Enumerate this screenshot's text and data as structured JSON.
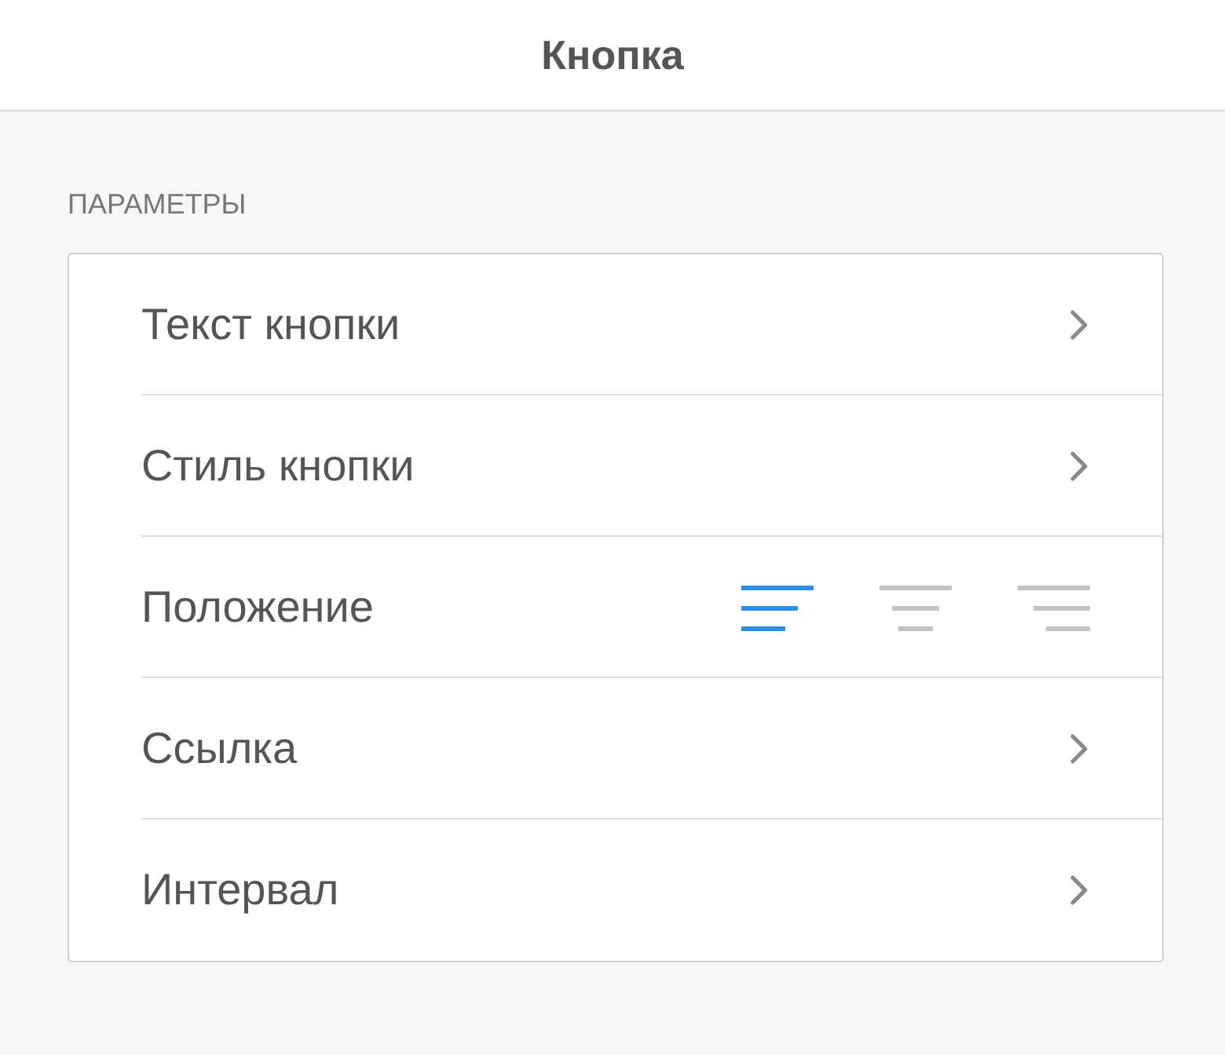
{
  "header": {
    "title": "Кнопка"
  },
  "section": {
    "label": "ПАРАМЕТРЫ"
  },
  "rows": [
    {
      "kind": "link",
      "label": "Текст кнопки"
    },
    {
      "kind": "link",
      "label": "Стиль кнопки"
    },
    {
      "kind": "alignment",
      "label": "Положение",
      "options": [
        {
          "kind": "left",
          "selected": true
        },
        {
          "kind": "center",
          "selected": false
        },
        {
          "kind": "right",
          "selected": false
        }
      ]
    },
    {
      "kind": "link",
      "label": "Ссылка"
    },
    {
      "kind": "link",
      "label": "Интервал"
    }
  ]
}
